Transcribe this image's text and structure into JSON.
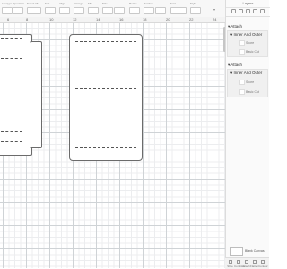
{
  "toolbar": {
    "labels": [
      "Linetype",
      "Operation",
      "Select All",
      "Edit",
      "Align",
      "Arrange",
      "Flip",
      "Size",
      "Rotate",
      "Position",
      "Font",
      "Style"
    ],
    "select_value": "Select All"
  },
  "ruler": {
    "marks": [
      "6",
      "8",
      "10",
      "12",
      "14",
      "16",
      "18",
      "20",
      "22",
      "24",
      "26",
      "28"
    ]
  },
  "layers_panel": {
    "tabs": [
      "Layers",
      "Color Sync"
    ],
    "groups": [
      {
        "title": "Attach",
        "child": "Inner And Outer",
        "item": "Score",
        "sub_item": "Basic Cut"
      },
      {
        "title": "Attach",
        "child": "Inner And Outer",
        "item": "Score",
        "sub_item": "Basic Cut"
      }
    ],
    "blank_canvas": "Blank Canvas",
    "bottom_tools": [
      "Slice",
      "Combine",
      "Attach",
      "Flatten",
      "Contour"
    ]
  }
}
